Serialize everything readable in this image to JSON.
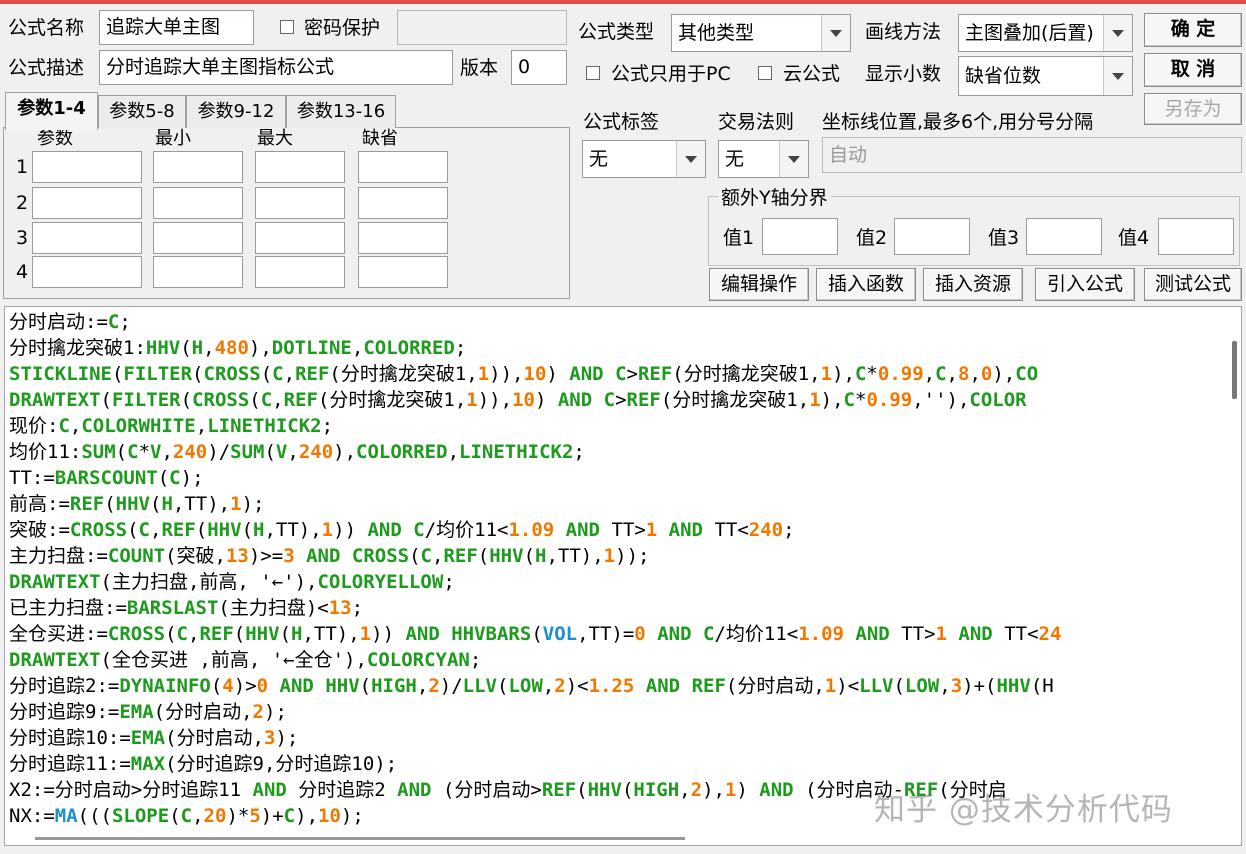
{
  "form": {
    "name_label": "公式名称",
    "name_value": "追踪大单主图",
    "password_label": "密码保护",
    "password_checked": false,
    "password_value": "",
    "desc_label": "公式描述",
    "desc_value": "分时追踪大单主图指标公式",
    "version_label": "版本",
    "version_value": "0",
    "type_label": "公式类型",
    "type_value": "其他类型",
    "draw_method_label": "画线方法",
    "draw_method_value": "主图叠加(后置)",
    "pc_only_label": "公式只用于PC",
    "pc_only_checked": false,
    "cloud_label": "云公式",
    "cloud_checked": false,
    "decimals_label": "显示小数",
    "decimals_value": "缺省位数",
    "tag_label": "公式标签",
    "tag_value": "无",
    "trade_rule_label": "交易法则",
    "trade_rule_value": "无",
    "coord_label": "坐标线位置,最多6个,用分号分隔",
    "coord_value": "自动",
    "yaxis_group_label": "额外Y轴分界",
    "yaxis": [
      {
        "label": "值1",
        "value": ""
      },
      {
        "label": "值2",
        "value": ""
      },
      {
        "label": "值3",
        "value": ""
      },
      {
        "label": "值4",
        "value": ""
      }
    ]
  },
  "buttons": {
    "ok": "确  定",
    "cancel": "取  消",
    "save_as": "另存为",
    "edit_ops": "编辑操作",
    "insert_func": "插入函数",
    "insert_resource": "插入资源",
    "import_formula": "引入公式",
    "test_formula": "测试公式"
  },
  "params": {
    "tabs": [
      "参数1-4",
      "参数5-8",
      "参数9-12",
      "参数13-16"
    ],
    "active_tab": 0,
    "headers": [
      "参数",
      "最小",
      "最大",
      "缺省"
    ],
    "rows": [
      "1",
      "2",
      "3",
      "4"
    ]
  },
  "colors": {
    "default_text": "#000000",
    "function": "#1e9a1e",
    "number": "#f07800",
    "special_func": "#1b8fd0",
    "window_accent": "#e04a4a"
  },
  "code_lines": [
    [
      [
        "分时启动:=",
        "t"
      ],
      [
        "C",
        "f"
      ],
      [
        ";",
        "t"
      ]
    ],
    [
      [
        "分时擒龙突破1:",
        "t"
      ],
      [
        "HHV",
        "f"
      ],
      [
        "(",
        "t"
      ],
      [
        "H",
        "f"
      ],
      [
        ",",
        "t"
      ],
      [
        "480",
        "n"
      ],
      [
        "),",
        "t"
      ],
      [
        "DOTLINE",
        "f"
      ],
      [
        ",",
        "t"
      ],
      [
        "COLORRED",
        "f"
      ],
      [
        ";",
        "t"
      ]
    ],
    [
      [
        "STICKLINE",
        "f"
      ],
      [
        "(",
        "t"
      ],
      [
        "FILTER",
        "f"
      ],
      [
        "(",
        "t"
      ],
      [
        "CROSS",
        "f"
      ],
      [
        "(",
        "t"
      ],
      [
        "C",
        "f"
      ],
      [
        ",",
        "t"
      ],
      [
        "REF",
        "f"
      ],
      [
        "(分时擒龙突破1,",
        "t"
      ],
      [
        "1",
        "n"
      ],
      [
        ")),",
        "t"
      ],
      [
        "10",
        "n"
      ],
      [
        ") ",
        "t"
      ],
      [
        "AND",
        "f"
      ],
      [
        " ",
        "t"
      ],
      [
        "C",
        "f"
      ],
      [
        ">",
        "t"
      ],
      [
        "REF",
        "f"
      ],
      [
        "(分时擒龙突破1,",
        "t"
      ],
      [
        "1",
        "n"
      ],
      [
        "),",
        "t"
      ],
      [
        "C",
        "f"
      ],
      [
        "*",
        "t"
      ],
      [
        "0.99",
        "n"
      ],
      [
        ",",
        "t"
      ],
      [
        "C",
        "f"
      ],
      [
        ",",
        "t"
      ],
      [
        "8",
        "n"
      ],
      [
        ",",
        "t"
      ],
      [
        "0",
        "n"
      ],
      [
        "),",
        "t"
      ],
      [
        "CO",
        "f"
      ]
    ],
    [
      [
        "DRAWTEXT",
        "f"
      ],
      [
        "(",
        "t"
      ],
      [
        "FILTER",
        "f"
      ],
      [
        "(",
        "t"
      ],
      [
        "CROSS",
        "f"
      ],
      [
        "(",
        "t"
      ],
      [
        "C",
        "f"
      ],
      [
        ",",
        "t"
      ],
      [
        "REF",
        "f"
      ],
      [
        "(分时擒龙突破1,",
        "t"
      ],
      [
        "1",
        "n"
      ],
      [
        ")),",
        "t"
      ],
      [
        "10",
        "n"
      ],
      [
        ") ",
        "t"
      ],
      [
        "AND",
        "f"
      ],
      [
        " ",
        "t"
      ],
      [
        "C",
        "f"
      ],
      [
        ">",
        "t"
      ],
      [
        "REF",
        "f"
      ],
      [
        "(分时擒龙突破1,",
        "t"
      ],
      [
        "1",
        "n"
      ],
      [
        "),",
        "t"
      ],
      [
        "C",
        "f"
      ],
      [
        "*",
        "t"
      ],
      [
        "0.99",
        "n"
      ],
      [
        ",''),",
        "t"
      ],
      [
        "COLOR",
        "f"
      ]
    ],
    [
      [
        "现价:",
        "t"
      ],
      [
        "C",
        "f"
      ],
      [
        ",",
        "t"
      ],
      [
        "COLORWHITE",
        "f"
      ],
      [
        ",",
        "t"
      ],
      [
        "LINETHICK2",
        "f"
      ],
      [
        ";",
        "t"
      ]
    ],
    [
      [
        "均价11:",
        "t"
      ],
      [
        "SUM",
        "f"
      ],
      [
        "(",
        "t"
      ],
      [
        "C",
        "f"
      ],
      [
        "*",
        "t"
      ],
      [
        "V",
        "f"
      ],
      [
        ",",
        "t"
      ],
      [
        "240",
        "n"
      ],
      [
        ")/",
        "t"
      ],
      [
        "SUM",
        "f"
      ],
      [
        "(",
        "t"
      ],
      [
        "V",
        "f"
      ],
      [
        ",",
        "t"
      ],
      [
        "240",
        "n"
      ],
      [
        "),",
        "t"
      ],
      [
        "COLORRED",
        "f"
      ],
      [
        ",",
        "t"
      ],
      [
        "LINETHICK2",
        "f"
      ],
      [
        ";",
        "t"
      ]
    ],
    [
      [
        "TT:=",
        "t"
      ],
      [
        "BARSCOUNT",
        "f"
      ],
      [
        "(",
        "t"
      ],
      [
        "C",
        "f"
      ],
      [
        ");",
        "t"
      ]
    ],
    [
      [
        "前高:=",
        "t"
      ],
      [
        "REF",
        "f"
      ],
      [
        "(",
        "t"
      ],
      [
        "HHV",
        "f"
      ],
      [
        "(",
        "t"
      ],
      [
        "H",
        "f"
      ],
      [
        ",TT),",
        "t"
      ],
      [
        "1",
        "n"
      ],
      [
        ");",
        "t"
      ]
    ],
    [
      [
        "突破:=",
        "t"
      ],
      [
        "CROSS",
        "f"
      ],
      [
        "(",
        "t"
      ],
      [
        "C",
        "f"
      ],
      [
        ",",
        "t"
      ],
      [
        "REF",
        "f"
      ],
      [
        "(",
        "t"
      ],
      [
        "HHV",
        "f"
      ],
      [
        "(",
        "t"
      ],
      [
        "H",
        "f"
      ],
      [
        ",TT),",
        "t"
      ],
      [
        "1",
        "n"
      ],
      [
        ")) ",
        "t"
      ],
      [
        "AND",
        "f"
      ],
      [
        " ",
        "t"
      ],
      [
        "C",
        "f"
      ],
      [
        "/均价11<",
        "t"
      ],
      [
        "1.09",
        "n"
      ],
      [
        " ",
        "t"
      ],
      [
        "AND",
        "f"
      ],
      [
        " TT>",
        "t"
      ],
      [
        "1",
        "n"
      ],
      [
        " ",
        "t"
      ],
      [
        "AND",
        "f"
      ],
      [
        " TT<",
        "t"
      ],
      [
        "240",
        "n"
      ],
      [
        ";",
        "t"
      ]
    ],
    [
      [
        "主力扫盘:=",
        "t"
      ],
      [
        "COUNT",
        "f"
      ],
      [
        "(突破,",
        "t"
      ],
      [
        "13",
        "n"
      ],
      [
        ")>=",
        "t"
      ],
      [
        "3",
        "n"
      ],
      [
        " ",
        "t"
      ],
      [
        "AND",
        "f"
      ],
      [
        " ",
        "t"
      ],
      [
        "CROSS",
        "f"
      ],
      [
        "(",
        "t"
      ],
      [
        "C",
        "f"
      ],
      [
        ",",
        "t"
      ],
      [
        "REF",
        "f"
      ],
      [
        "(",
        "t"
      ],
      [
        "HHV",
        "f"
      ],
      [
        "(",
        "t"
      ],
      [
        "H",
        "f"
      ],
      [
        ",TT),",
        "t"
      ],
      [
        "1",
        "n"
      ],
      [
        "));",
        "t"
      ]
    ],
    [
      [
        "DRAWTEXT",
        "f"
      ],
      [
        "(主力扫盘,前高, '←'),",
        "t"
      ],
      [
        "COLORYELLOW",
        "f"
      ],
      [
        ";",
        "t"
      ]
    ],
    [
      [
        "已主力扫盘:=",
        "t"
      ],
      [
        "BARSLAST",
        "f"
      ],
      [
        "(主力扫盘)<",
        "t"
      ],
      [
        "13",
        "n"
      ],
      [
        ";",
        "t"
      ]
    ],
    [
      [
        "全仓买进:=",
        "t"
      ],
      [
        "CROSS",
        "f"
      ],
      [
        "(",
        "t"
      ],
      [
        "C",
        "f"
      ],
      [
        ",",
        "t"
      ],
      [
        "REF",
        "f"
      ],
      [
        "(",
        "t"
      ],
      [
        "HHV",
        "f"
      ],
      [
        "(",
        "t"
      ],
      [
        "H",
        "f"
      ],
      [
        ",TT),",
        "t"
      ],
      [
        "1",
        "n"
      ],
      [
        ")) ",
        "t"
      ],
      [
        "AND",
        "f"
      ],
      [
        " ",
        "t"
      ],
      [
        "HHVBARS",
        "f"
      ],
      [
        "(",
        "t"
      ],
      [
        "VOL",
        "s"
      ],
      [
        ",TT)=",
        "t"
      ],
      [
        "0",
        "n"
      ],
      [
        " ",
        "t"
      ],
      [
        "AND",
        "f"
      ],
      [
        " ",
        "t"
      ],
      [
        "C",
        "f"
      ],
      [
        "/均价11<",
        "t"
      ],
      [
        "1.09",
        "n"
      ],
      [
        " ",
        "t"
      ],
      [
        "AND",
        "f"
      ],
      [
        " TT>",
        "t"
      ],
      [
        "1",
        "n"
      ],
      [
        " ",
        "t"
      ],
      [
        "AND",
        "f"
      ],
      [
        " TT<",
        "t"
      ],
      [
        "24",
        "n"
      ]
    ],
    [
      [
        "DRAWTEXT",
        "f"
      ],
      [
        "(全仓买进 ,前高, '←全仓'),",
        "t"
      ],
      [
        "COLORCYAN",
        "f"
      ],
      [
        ";",
        "t"
      ]
    ],
    [
      [
        "分时追踪2:=",
        "t"
      ],
      [
        "DYNAINFO",
        "f"
      ],
      [
        "(",
        "t"
      ],
      [
        "4",
        "n"
      ],
      [
        ")>",
        "t"
      ],
      [
        "0",
        "n"
      ],
      [
        " ",
        "t"
      ],
      [
        "AND",
        "f"
      ],
      [
        " ",
        "t"
      ],
      [
        "HHV",
        "f"
      ],
      [
        "(",
        "t"
      ],
      [
        "HIGH",
        "f"
      ],
      [
        ",",
        "t"
      ],
      [
        "2",
        "n"
      ],
      [
        ")/",
        "t"
      ],
      [
        "LLV",
        "f"
      ],
      [
        "(",
        "t"
      ],
      [
        "LOW",
        "f"
      ],
      [
        ",",
        "t"
      ],
      [
        "2",
        "n"
      ],
      [
        ")<",
        "t"
      ],
      [
        "1.25",
        "n"
      ],
      [
        " ",
        "t"
      ],
      [
        "AND",
        "f"
      ],
      [
        " ",
        "t"
      ],
      [
        "REF",
        "f"
      ],
      [
        "(分时启动,",
        "t"
      ],
      [
        "1",
        "n"
      ],
      [
        ")<",
        "t"
      ],
      [
        "LLV",
        "f"
      ],
      [
        "(",
        "t"
      ],
      [
        "LOW",
        "f"
      ],
      [
        ",",
        "t"
      ],
      [
        "3",
        "n"
      ],
      [
        ")+(",
        "t"
      ],
      [
        "HHV",
        "f"
      ],
      [
        "(H",
        "t"
      ]
    ],
    [
      [
        "分时追踪9:=",
        "t"
      ],
      [
        "EMA",
        "f"
      ],
      [
        "(分时启动,",
        "t"
      ],
      [
        "2",
        "n"
      ],
      [
        ");",
        "t"
      ]
    ],
    [
      [
        "分时追踪10:=",
        "t"
      ],
      [
        "EMA",
        "f"
      ],
      [
        "(分时启动,",
        "t"
      ],
      [
        "3",
        "n"
      ],
      [
        ");",
        "t"
      ]
    ],
    [
      [
        "分时追踪11:=",
        "t"
      ],
      [
        "MAX",
        "f"
      ],
      [
        "(分时追踪9,分时追踪10);",
        "t"
      ]
    ],
    [
      [
        "X2:=分时启动>分时追踪11 ",
        "t"
      ],
      [
        "AND",
        "f"
      ],
      [
        " 分时追踪2 ",
        "t"
      ],
      [
        "AND",
        "f"
      ],
      [
        " (分时启动>",
        "t"
      ],
      [
        "REF",
        "f"
      ],
      [
        "(",
        "t"
      ],
      [
        "HHV",
        "f"
      ],
      [
        "(",
        "t"
      ],
      [
        "HIGH",
        "f"
      ],
      [
        ",",
        "t"
      ],
      [
        "2",
        "n"
      ],
      [
        "),",
        "t"
      ],
      [
        "1",
        "n"
      ],
      [
        ") ",
        "t"
      ],
      [
        "AND",
        "f"
      ],
      [
        " (分时启动-",
        "t"
      ],
      [
        "REF",
        "f"
      ],
      [
        "(分时启",
        "t"
      ]
    ],
    [
      [
        "NX:=",
        "t"
      ],
      [
        "MA",
        "s"
      ],
      [
        "(((",
        "t"
      ],
      [
        "SLOPE",
        "f"
      ],
      [
        "(",
        "t"
      ],
      [
        "C",
        "f"
      ],
      [
        ",",
        "t"
      ],
      [
        "20",
        "n"
      ],
      [
        ")*",
        "t"
      ],
      [
        "5",
        "n"
      ],
      [
        ")+",
        "t"
      ],
      [
        "C",
        "f"
      ],
      [
        "),",
        "t"
      ],
      [
        "10",
        "n"
      ],
      [
        ");",
        "t"
      ]
    ]
  ],
  "watermark": "知乎 @技术分析代码"
}
